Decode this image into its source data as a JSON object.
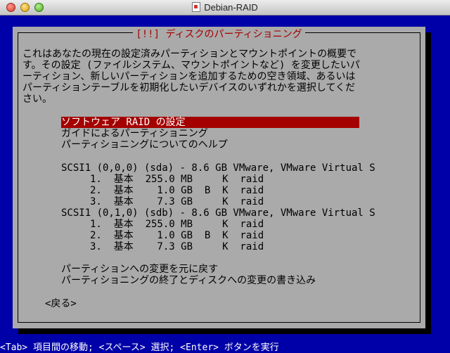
{
  "window": {
    "title": "Debian-RAID"
  },
  "dialog": {
    "title": "[!!] ディスクのパーティショニング",
    "description": [
      "これはあなたの現在の設定済みパーティションとマウントポイントの概要で",
      "す。その設定 (ファイルシステム、マウントポイントなど) を変更したいパ",
      "ーティション、新しいパーティションを追加するための空き領域、あるいは",
      "パーティションテーブルを初期化したいデバイスのいずれかを選択してくだ",
      "さい。"
    ],
    "menu_top": [
      "ソフトウェア RAID の設定",
      "ガイドによるパーティショニング",
      "パーティショニングについてのヘルプ"
    ],
    "disks": [
      {
        "header": "SCSI1 (0,0,0) (sda) - 8.6 GB VMware, VMware Virtual S",
        "partitions": [
          "1.  基本  255.0 MB     K  raid",
          "2.  基本    1.0 GB  B  K  raid",
          "3.  基本    7.3 GB     K  raid"
        ]
      },
      {
        "header": "SCSI1 (0,1,0) (sdb) - 8.6 GB VMware, VMware Virtual S",
        "partitions": [
          "1.  基本  255.0 MB     K  raid",
          "2.  基本    1.0 GB  B  K  raid",
          "3.  基本    7.3 GB     K  raid"
        ]
      }
    ],
    "menu_bottom": [
      "パーティションへの変更を元に戻す",
      "パーティショニングの終了とディスクへの変更の書き込み"
    ],
    "back_label": "<戻る>"
  },
  "status_bar": "<Tab> 項目間の移動; <スペース> 選択; <Enter> ボタンを実行",
  "colors": {
    "screen_bg": "#0000a8",
    "dialog_bg": "#aaaaaa",
    "highlight": "#a40000"
  }
}
